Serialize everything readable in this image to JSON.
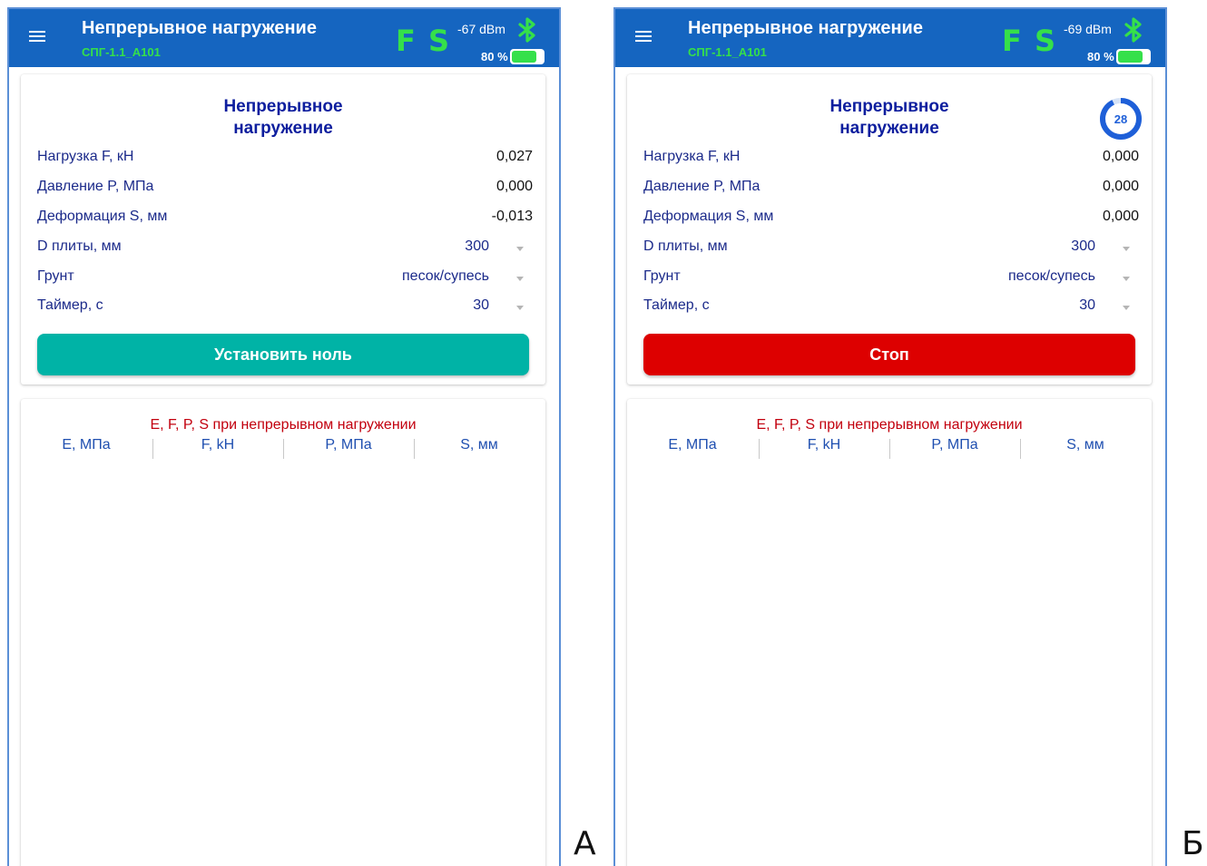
{
  "panels": [
    {
      "app_title": "Непрерывное нагружение",
      "device_name": "СПГ-1.1_А101",
      "indicator_f": "F",
      "indicator_s": "S",
      "signal": "-67 dBm",
      "battery_label": "80 %",
      "battery_level": 0.8,
      "card_title_line1": "Непрерывное",
      "card_title_line2": "нагружение",
      "rows": [
        {
          "label": "Нагрузка F, кН",
          "value": "0,027"
        },
        {
          "label": "Давление P, МПа",
          "value": "0,000"
        },
        {
          "label": "Деформация S, мм",
          "value": "-0,013"
        }
      ],
      "selects": [
        {
          "label": "D плиты, мм",
          "value": "300"
        },
        {
          "label": "Грунт",
          "value": "песок/супесь"
        },
        {
          "label": "Таймер, с",
          "value": "30"
        }
      ],
      "button_label": "Установить ноль",
      "table_title": "E, F, P, S при непрерывном нагружении",
      "table_headers": [
        "E, МПа",
        "F, kH",
        "P, МПа",
        "S, мм"
      ],
      "panel_letter": "А"
    },
    {
      "app_title": "Непрерывное нагружение",
      "device_name": "СПГ-1.1_А101",
      "indicator_f": "F",
      "indicator_s": "S",
      "signal": "-69 dBm",
      "battery_label": "80 %",
      "battery_level": 0.8,
      "card_title_line1": "Непрерывное",
      "card_title_line2": "нагружение",
      "timer_count": "28",
      "timer_progress": 0.93,
      "rows": [
        {
          "label": "Нагрузка F, кН",
          "value": "0,000"
        },
        {
          "label": "Давление P, МПа",
          "value": "0,000"
        },
        {
          "label": "Деформация S, мм",
          "value": "0,000"
        }
      ],
      "selects": [
        {
          "label": "D плиты, мм",
          "value": "300"
        },
        {
          "label": "Грунт",
          "value": "песок/супесь"
        },
        {
          "label": "Таймер, с",
          "value": "30"
        }
      ],
      "button_label": "Стоп",
      "table_title": "E, F, P, S при непрерывном нагружении",
      "table_headers": [
        "E, МПа",
        "F, kH",
        "P, МПа",
        "S, мм"
      ],
      "panel_letter": "Б"
    }
  ],
  "colors": {
    "app_bar": "#1565c0",
    "status_green": "#35e04a",
    "button_zero": "#00b3a6",
    "button_stop": "#dd0000",
    "table_title": "#c2000e"
  }
}
